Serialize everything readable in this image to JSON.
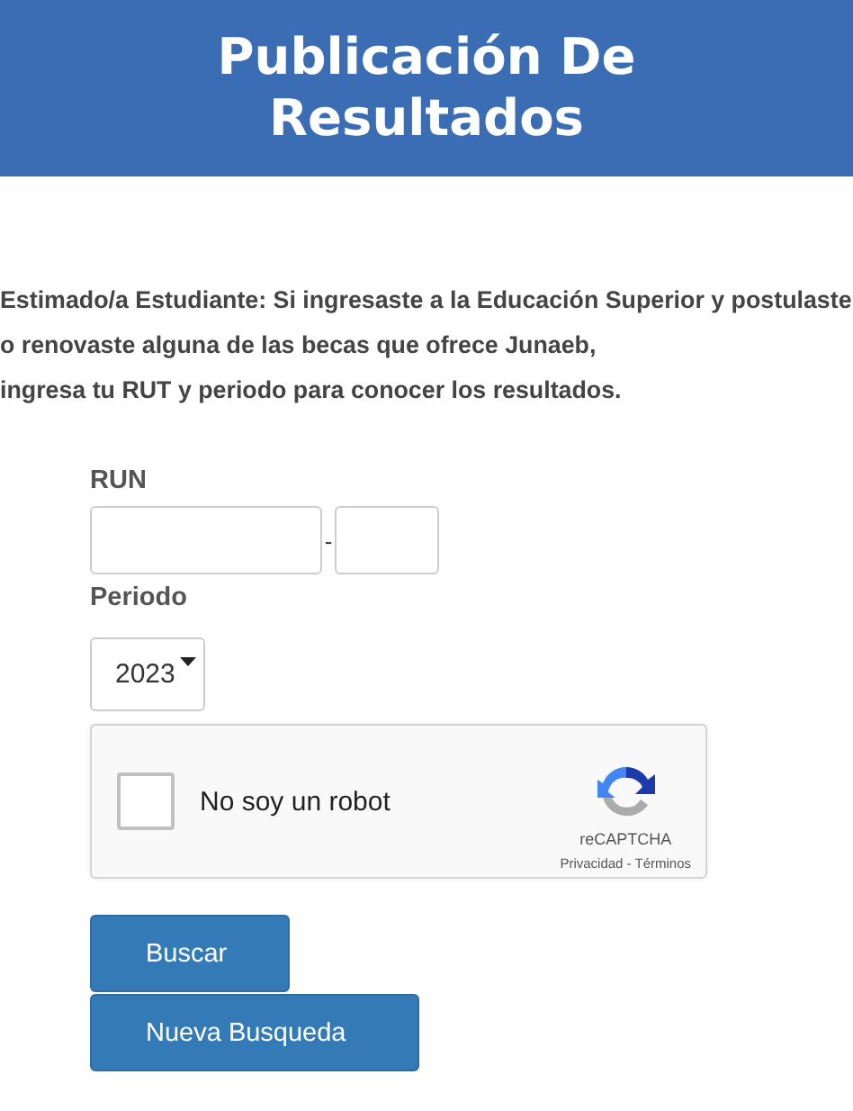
{
  "header": {
    "title": "Publicación De Resultados"
  },
  "intro": "Estimado/a Estudiante: Si ingresaste a la Educación Superior y postulaste o renovaste alguna de las becas que ofrece Junaeb, ingresa tu RUT y periodo para conocer los resultados.",
  "form": {
    "run_label": "RUN",
    "separator": "-",
    "period_label": "Periodo",
    "period_value": "2023"
  },
  "captcha": {
    "label": "No soy un robot",
    "checked": false,
    "brand": "reCAPTCHA",
    "privacy": "Privacidad",
    "dot": "-",
    "terms": "Términos"
  },
  "buttons": [
    "Buscar",
    "Nueva Busqueda"
  ]
}
